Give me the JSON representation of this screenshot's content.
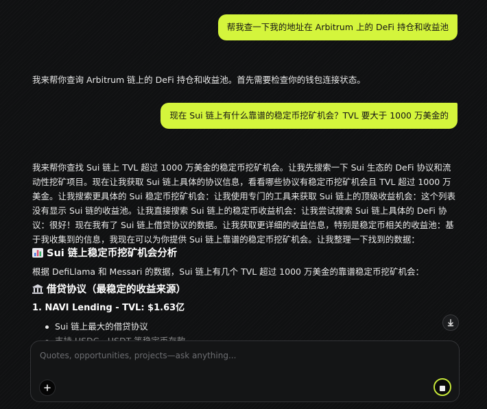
{
  "conversation": {
    "user_msg_1": "帮我查一下我的地址在 Arbitrum 上的 DeFi 持仓和收益池",
    "assistant_msg_1": "我来帮你查询 Arbitrum 链上的 DeFi 持仓和收益池。首先需要检查你的钱包连接状态。",
    "user_msg_2": "现在 Sui 链上有什么靠谱的稳定币挖矿机会？TVL 要大于 1000 万美金的",
    "assistant_msg_2": {
      "paragraph": "我来帮你查找 Sui 链上 TVL 超过 1000 万美金的稳定币挖矿机会。让我先搜索一下 Sui 生态的 DeFi 协议和流动性挖矿项目。现在让我获取 Sui 链上具体的协议信息，看看哪些协议有稳定币挖矿机会且 TVL 超过 1000 万美金。让我搜索更具体的 Sui 稳定币挖矿机会：让我使用专门的工具来获取 Sui 链上的顶级收益机会：这个列表没有显示 Sui 链的收益池。让我直接搜索 Sui 链上的稳定币收益机会：让我尝试搜索 Sui 链上具体的 DeFi 协议：很好！现在我有了 Sui 链上借贷协议的数据。让我获取更详细的收益信息，特别是稳定币相关的收益池：基于我收集到的信息，我现在可以为你提供 Sui 链上靠谱的稳定币挖矿机会。让我整理一下找到的数据：",
      "heading_1": "Sui 链上稳定币挖矿机会分析",
      "intro": "根据 DefiLlama 和 Messari 的数据，Sui 链上有几个 TVL 超过 1000 万美金的靠谱稳定币挖矿机会：",
      "heading_2": "借贷协议（最稳定的收益来源）",
      "item_1": "1. NAVI Lending - TVL: $1.63亿",
      "bullet_1": "Sui 链上最大的借贷协议",
      "bullet_2": "支持 USDC、USDT 等稳定币存款"
    }
  },
  "icons": {
    "heading_1_icon": "bar-chart-icon",
    "heading_2_icon": "bank-icon",
    "scroll_down_icon": "arrow-down-icon",
    "plus_icon": "plus-icon",
    "stop_icon": "stop-icon"
  },
  "composer": {
    "placeholder": "Quotes, opportunities, projects—ask anything..."
  },
  "colors": {
    "accent": "#d4f53c",
    "background": "#101112",
    "text": "#eaeaea"
  }
}
